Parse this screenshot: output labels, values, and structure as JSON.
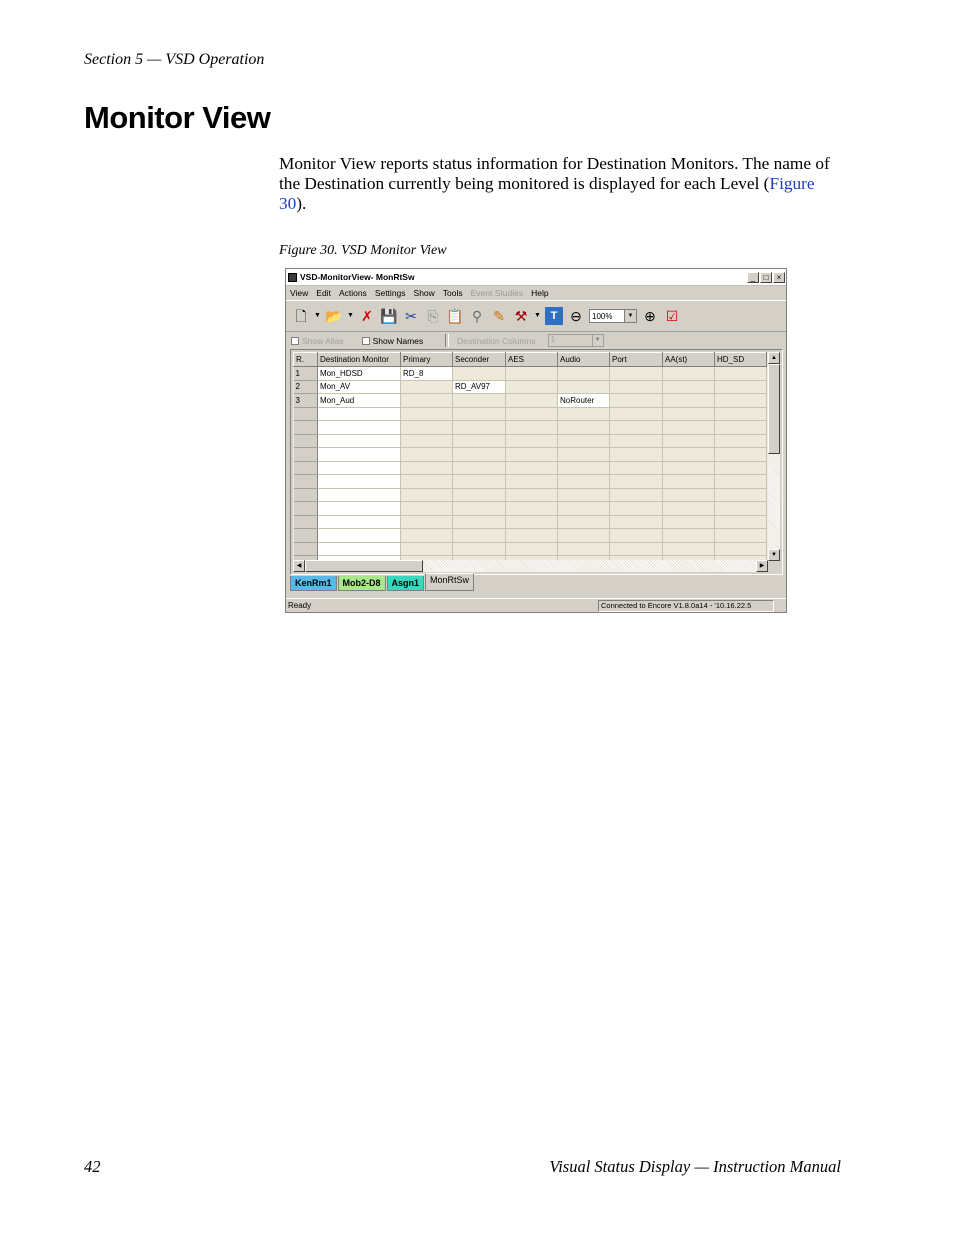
{
  "page": {
    "running_head": "Section 5 — VSD Operation",
    "title": "Monitor View",
    "intro_before": "Monitor View reports status information for Destination Monitors. The name of the Destination currently being monitored is displayed for each Level (",
    "intro_link": "Figure 30",
    "intro_after": ").",
    "caption": "Figure 30.  VSD Monitor View",
    "footer_page_number": "42",
    "footer_title": "Visual Status Display  —  Instruction Manual"
  },
  "screenshot": {
    "window_title": "VSD-MonitorView- MonRtSw",
    "window_buttons": {
      "minimize": "_",
      "maximize": "□",
      "close": "×"
    },
    "menu": [
      "View",
      "Edit",
      "Actions",
      "Settings",
      "Show",
      "Tools",
      "Event Studies",
      "Help"
    ],
    "menu_disabled": "Event Studies",
    "zoom_value": "100%",
    "options": {
      "show_alias": "Show Alias",
      "show_names": "Show Names",
      "destination_columns_label": "Destination Columns",
      "destination_columns_value": "1"
    },
    "grid": {
      "headers": [
        "R.",
        "Destination Monitor",
        "Primary",
        "Seconder",
        "AES",
        "Audio",
        "Port",
        "AA(st)",
        "HD_SD"
      ],
      "rows": [
        {
          "n": "1",
          "dest": "Mon_HDSD",
          "cells": [
            "RD_8",
            "",
            "",
            "",
            "",
            "",
            ""
          ]
        },
        {
          "n": "2",
          "dest": "Mon_AV",
          "cells": [
            "",
            "RD_AV97",
            "",
            "",
            "",
            "",
            ""
          ]
        },
        {
          "n": "3",
          "dest": "Mon_Aud",
          "cells": [
            "",
            "",
            "",
            "NoRouter",
            "",
            "",
            ""
          ]
        }
      ],
      "empty_rows": 12
    },
    "tabs": [
      {
        "label": "KenRm1",
        "color": "#5ab8e8"
      },
      {
        "label": "Mob2-D8",
        "color": "#a8e88a"
      },
      {
        "label": "Asgn1",
        "color": "#38d8c0"
      },
      {
        "label": "MonRtSw",
        "color": "#d4d0c8"
      }
    ],
    "status_left": "Ready",
    "status_right": "Connected to Encore V1.8.0a14 - '10.16.22.5"
  }
}
